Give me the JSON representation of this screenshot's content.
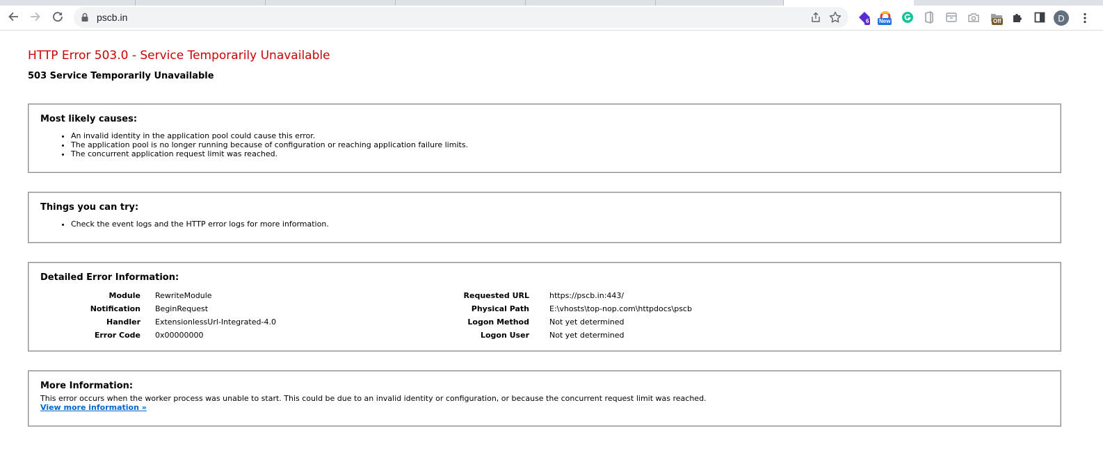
{
  "browser": {
    "url": "pscb.in",
    "extension_badges": {
      "purple_ext": "6",
      "chromatic_ext": "New",
      "off_ext": "Off"
    },
    "avatar_letter": "D",
    "colors": {
      "grammarly_green": "#15c39a",
      "purple_ext": "#5b2bd6",
      "badge_blue": "#1a73e8",
      "badge_brown": "#7a5a2f"
    },
    "icons": [
      "back-arrow-icon",
      "forward-arrow-icon",
      "reload-icon",
      "lock-icon",
      "share-icon",
      "star-icon",
      "puzzle-icon",
      "side-panel-icon",
      "three-dots-icon"
    ]
  },
  "page": {
    "title": "HTTP Error 503.0 - Service Temporarily Unavailable",
    "subtitle": "503 Service Temporarily Unavailable",
    "causes": {
      "heading": "Most likely causes:",
      "items": [
        "An invalid identity in the application pool could cause this error.",
        "The application pool is no longer running because of configuration or reaching application failure limits.",
        "The concurrent application request limit was reached."
      ]
    },
    "try": {
      "heading": "Things you can try:",
      "items": [
        "Check the event logs and the HTTP error logs for more information."
      ]
    },
    "details": {
      "heading": "Detailed Error Information:",
      "left": [
        {
          "label": "Module",
          "value": "RewriteModule"
        },
        {
          "label": "Notification",
          "value": "BeginRequest"
        },
        {
          "label": "Handler",
          "value": "ExtensionlessUrl-Integrated-4.0"
        },
        {
          "label": "Error Code",
          "value": "0x00000000"
        }
      ],
      "right": [
        {
          "label": "Requested URL",
          "value": "https://pscb.in:443/"
        },
        {
          "label": "Physical Path",
          "value": "E:\\vhosts\\top-nop.com\\httpdocs\\pscb"
        },
        {
          "label": "Logon Method",
          "value": "Not yet determined"
        },
        {
          "label": "Logon User",
          "value": "Not yet determined"
        }
      ]
    },
    "more": {
      "heading": "More Information:",
      "text": "This error occurs when the worker process was unable to start. This could be due to an invalid identity or configuration, or because the concurrent request limit was reached.",
      "link": "View more information »"
    },
    "colors": {
      "title_red": "#cc0000",
      "link_blue": "#0066cc"
    }
  }
}
